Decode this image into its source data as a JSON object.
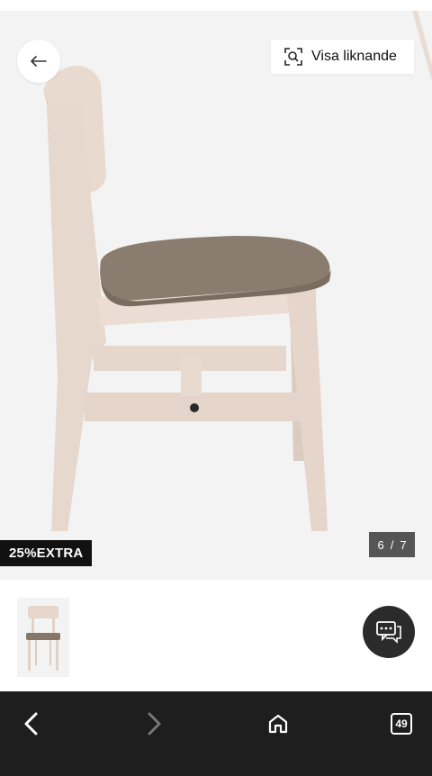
{
  "gallery": {
    "back_icon": "arrow-left-icon",
    "visual_search": {
      "icon": "visual-search-icon",
      "label": "Visa liknande"
    },
    "promo_badge": "25%EXTRA",
    "counter": {
      "current": "6",
      "separator": "/",
      "total": "7"
    },
    "background_color": "#f3f3f3"
  },
  "thumbnails": [
    {
      "icon": "chair-thumbnail"
    }
  ],
  "chat": {
    "icon": "chat-bubble-icon"
  },
  "browser_toolbar": {
    "back_icon": "chevron-left-icon",
    "forward_icon": "chevron-right-icon",
    "home_icon": "home-icon",
    "tabs_count": "49"
  }
}
